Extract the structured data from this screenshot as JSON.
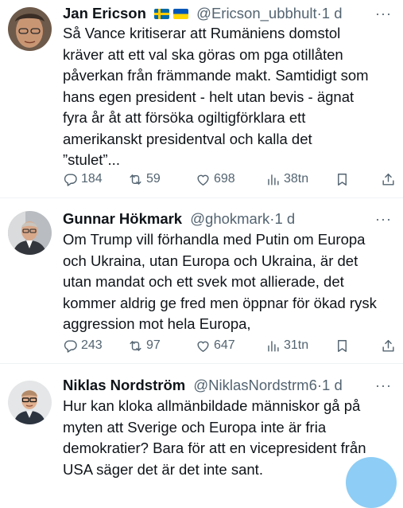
{
  "tweets": [
    {
      "name": "Jan Ericson",
      "flags": [
        "swedish-flag",
        "ukrainian-flag"
      ],
      "handle": "@Ericson_ubbhult",
      "separator": "·",
      "time": "1 d",
      "more": "···",
      "lines": [
        "Så Vance kritiserar att Rumäniens domstol",
        "kräver att ett val ska göras om pga otillåten",
        "påverkan från främmande makt. Samtidigt som",
        "hans egen president - helt utan bevis - ägnat",
        "fyra år åt att försöka ogiltigförklara ett",
        "amerikanskt presidentval och kalla det",
        "”stulet”..."
      ],
      "replies": "184",
      "reposts": "59",
      "likes": "698",
      "views": "38tn"
    },
    {
      "name": "Gunnar Hökmark",
      "flags": [],
      "handle": "@ghokmark",
      "separator": "·",
      "time": "1 d",
      "more": "···",
      "lines": [
        "Om Trump vill förhandla med Putin om Europa",
        "och Ukraina, utan Europa och Ukraina, är det",
        "utan mandat och ett svek mot allierade, det",
        "kommer aldrig ge fred men öppnar för ökad rysk",
        "aggression mot hela Europa,"
      ],
      "replies": "243",
      "reposts": "97",
      "likes": "647",
      "views": "31tn"
    },
    {
      "name": "Niklas Nordström",
      "flags": [],
      "handle": "@NiklasNordstrm6",
      "separator": "·",
      "time": "1 d",
      "more": "···",
      "lines": [
        "Hur kan kloka allmänbildade människor gå på",
        "myten att Sverige och Europa inte är fria",
        "demokratier? Bara för att en vicepresident från",
        "USA säger det är det inte sant."
      ]
    }
  ],
  "colors": {
    "text": "#0f1419",
    "secondary": "#536471",
    "divider": "#eff3f4",
    "fab": "#8ecdf5"
  },
  "icons": {
    "reply": "reply-icon",
    "repost": "repost-icon",
    "like": "heart-icon",
    "views": "views-icon",
    "bookmark": "bookmark-icon",
    "share": "share-icon"
  }
}
